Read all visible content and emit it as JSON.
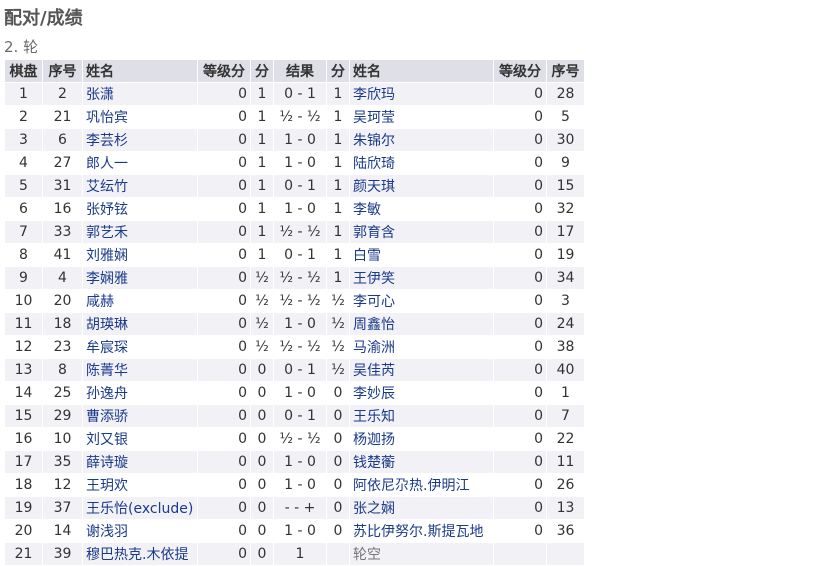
{
  "page": {
    "title": "配对/成绩",
    "round_title": "2. 轮"
  },
  "table": {
    "headers": {
      "board": "棋盘",
      "white_no": "序号",
      "white_name": "姓名",
      "white_rating": "等级分",
      "white_points": "分",
      "result": "结果",
      "black_points": "分",
      "black_name": "姓名",
      "black_rating": "等级分",
      "black_no": "序号"
    },
    "rows": [
      {
        "board": "1",
        "white_no": "2",
        "white_name": "张潇",
        "white_rating": "0",
        "white_points": "1",
        "result": "0 - 1",
        "black_points": "1",
        "black_name": "李欣玛",
        "black_rating": "0",
        "black_no": "28"
      },
      {
        "board": "2",
        "white_no": "21",
        "white_name": "巩怡宾",
        "white_rating": "0",
        "white_points": "1",
        "result": "½ - ½",
        "black_points": "1",
        "black_name": "吴珂莹",
        "black_rating": "0",
        "black_no": "5"
      },
      {
        "board": "3",
        "white_no": "6",
        "white_name": "李芸杉",
        "white_rating": "0",
        "white_points": "1",
        "result": "1 - 0",
        "black_points": "1",
        "black_name": "朱锦尔",
        "black_rating": "0",
        "black_no": "30"
      },
      {
        "board": "4",
        "white_no": "27",
        "white_name": "郎人一",
        "white_rating": "0",
        "white_points": "1",
        "result": "1 - 0",
        "black_points": "1",
        "black_name": "陆欣琦",
        "black_rating": "0",
        "black_no": "9"
      },
      {
        "board": "5",
        "white_no": "31",
        "white_name": "艾纭竹",
        "white_rating": "0",
        "white_points": "1",
        "result": "0 - 1",
        "black_points": "1",
        "black_name": "颜天琪",
        "black_rating": "0",
        "black_no": "15"
      },
      {
        "board": "6",
        "white_no": "16",
        "white_name": "张妤铉",
        "white_rating": "0",
        "white_points": "1",
        "result": "1 - 0",
        "black_points": "1",
        "black_name": "李敏",
        "black_rating": "0",
        "black_no": "32"
      },
      {
        "board": "7",
        "white_no": "33",
        "white_name": "郭艺禾",
        "white_rating": "0",
        "white_points": "1",
        "result": "½ - ½",
        "black_points": "1",
        "black_name": "郭育含",
        "black_rating": "0",
        "black_no": "17"
      },
      {
        "board": "8",
        "white_no": "41",
        "white_name": "刘雅娴",
        "white_rating": "0",
        "white_points": "1",
        "result": "0 - 1",
        "black_points": "1",
        "black_name": "白雪",
        "black_rating": "0",
        "black_no": "19"
      },
      {
        "board": "9",
        "white_no": "4",
        "white_name": "李娴雅",
        "white_rating": "0",
        "white_points": "½",
        "result": "½ - ½",
        "black_points": "1",
        "black_name": "王伊笑",
        "black_rating": "0",
        "black_no": "34"
      },
      {
        "board": "10",
        "white_no": "20",
        "white_name": "咸赫",
        "white_rating": "0",
        "white_points": "½",
        "result": "½ - ½",
        "black_points": "½",
        "black_name": "李可心",
        "black_rating": "0",
        "black_no": "3"
      },
      {
        "board": "11",
        "white_no": "18",
        "white_name": "胡瑛琳",
        "white_rating": "0",
        "white_points": "½",
        "result": "1 - 0",
        "black_points": "½",
        "black_name": "周鑫怡",
        "black_rating": "0",
        "black_no": "24"
      },
      {
        "board": "12",
        "white_no": "23",
        "white_name": "牟宸琛",
        "white_rating": "0",
        "white_points": "½",
        "result": "½ - ½",
        "black_points": "½",
        "black_name": "马渝洲",
        "black_rating": "0",
        "black_no": "38"
      },
      {
        "board": "13",
        "white_no": "8",
        "white_name": "陈菁华",
        "white_rating": "0",
        "white_points": "0",
        "result": "0 - 1",
        "black_points": "½",
        "black_name": "吴佳芮",
        "black_rating": "0",
        "black_no": "40"
      },
      {
        "board": "14",
        "white_no": "25",
        "white_name": "孙逸舟",
        "white_rating": "0",
        "white_points": "0",
        "result": "1 - 0",
        "black_points": "0",
        "black_name": "李妙辰",
        "black_rating": "0",
        "black_no": "1"
      },
      {
        "board": "15",
        "white_no": "29",
        "white_name": "曹添骄",
        "white_rating": "0",
        "white_points": "0",
        "result": "0 - 1",
        "black_points": "0",
        "black_name": "王乐知",
        "black_rating": "0",
        "black_no": "7"
      },
      {
        "board": "16",
        "white_no": "10",
        "white_name": "刘又银",
        "white_rating": "0",
        "white_points": "0",
        "result": "½ - ½",
        "black_points": "0",
        "black_name": "杨迦扬",
        "black_rating": "0",
        "black_no": "22"
      },
      {
        "board": "17",
        "white_no": "35",
        "white_name": "薛诗璇",
        "white_rating": "0",
        "white_points": "0",
        "result": "1 - 0",
        "black_points": "0",
        "black_name": "钱楚蘅",
        "black_rating": "0",
        "black_no": "11"
      },
      {
        "board": "18",
        "white_no": "12",
        "white_name": "王玥欢",
        "white_rating": "0",
        "white_points": "0",
        "result": "1 - 0",
        "black_points": "0",
        "black_name": "阿依尼尕热.伊明江",
        "black_rating": "0",
        "black_no": "26"
      },
      {
        "board": "19",
        "white_no": "37",
        "white_name": "王乐怡(exclude)",
        "white_rating": "0",
        "white_points": "0",
        "result": "- - +",
        "black_points": "0",
        "black_name": "张之娴",
        "black_rating": "0",
        "black_no": "13"
      },
      {
        "board": "20",
        "white_no": "14",
        "white_name": "谢浅羽",
        "white_rating": "0",
        "white_points": "0",
        "result": "1 - 0",
        "black_points": "0",
        "black_name": "苏比伊努尔.斯提瓦地",
        "black_rating": "0",
        "black_no": "36"
      },
      {
        "board": "21",
        "white_no": "39",
        "white_name": "穆巴热克.木依提",
        "white_rating": "0",
        "white_points": "0",
        "result": "1",
        "black_points": "",
        "black_name": "轮空",
        "black_rating": "",
        "black_no": "",
        "bye": true
      }
    ]
  }
}
